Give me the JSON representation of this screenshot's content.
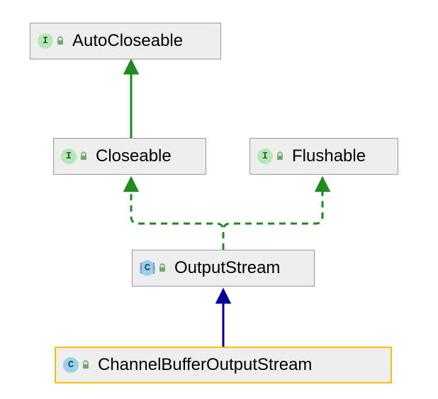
{
  "diagram": {
    "nodes": {
      "autocloseable": {
        "label": "AutoCloseable",
        "kind": "interface",
        "abstract": false,
        "selected": false
      },
      "closeable": {
        "label": "Closeable",
        "kind": "interface",
        "abstract": false,
        "selected": false
      },
      "flushable": {
        "label": "Flushable",
        "kind": "interface",
        "abstract": false,
        "selected": false
      },
      "outputstream": {
        "label": "OutputStream",
        "kind": "class",
        "abstract": true,
        "selected": false
      },
      "cbos": {
        "label": "ChannelBufferOutputStream",
        "kind": "class",
        "abstract": false,
        "selected": true
      }
    },
    "edges": [
      {
        "from": "closeable",
        "to": "autocloseable",
        "style": "extends-interface"
      },
      {
        "from": "outputstream",
        "to": "closeable",
        "style": "implements"
      },
      {
        "from": "outputstream",
        "to": "flushable",
        "style": "implements"
      },
      {
        "from": "cbos",
        "to": "outputstream",
        "style": "extends-class"
      }
    ],
    "colors": {
      "extends_interface": "#1f8a1f",
      "implements_dashed": "#1f8a1f",
      "extends_class": "#000099"
    }
  }
}
